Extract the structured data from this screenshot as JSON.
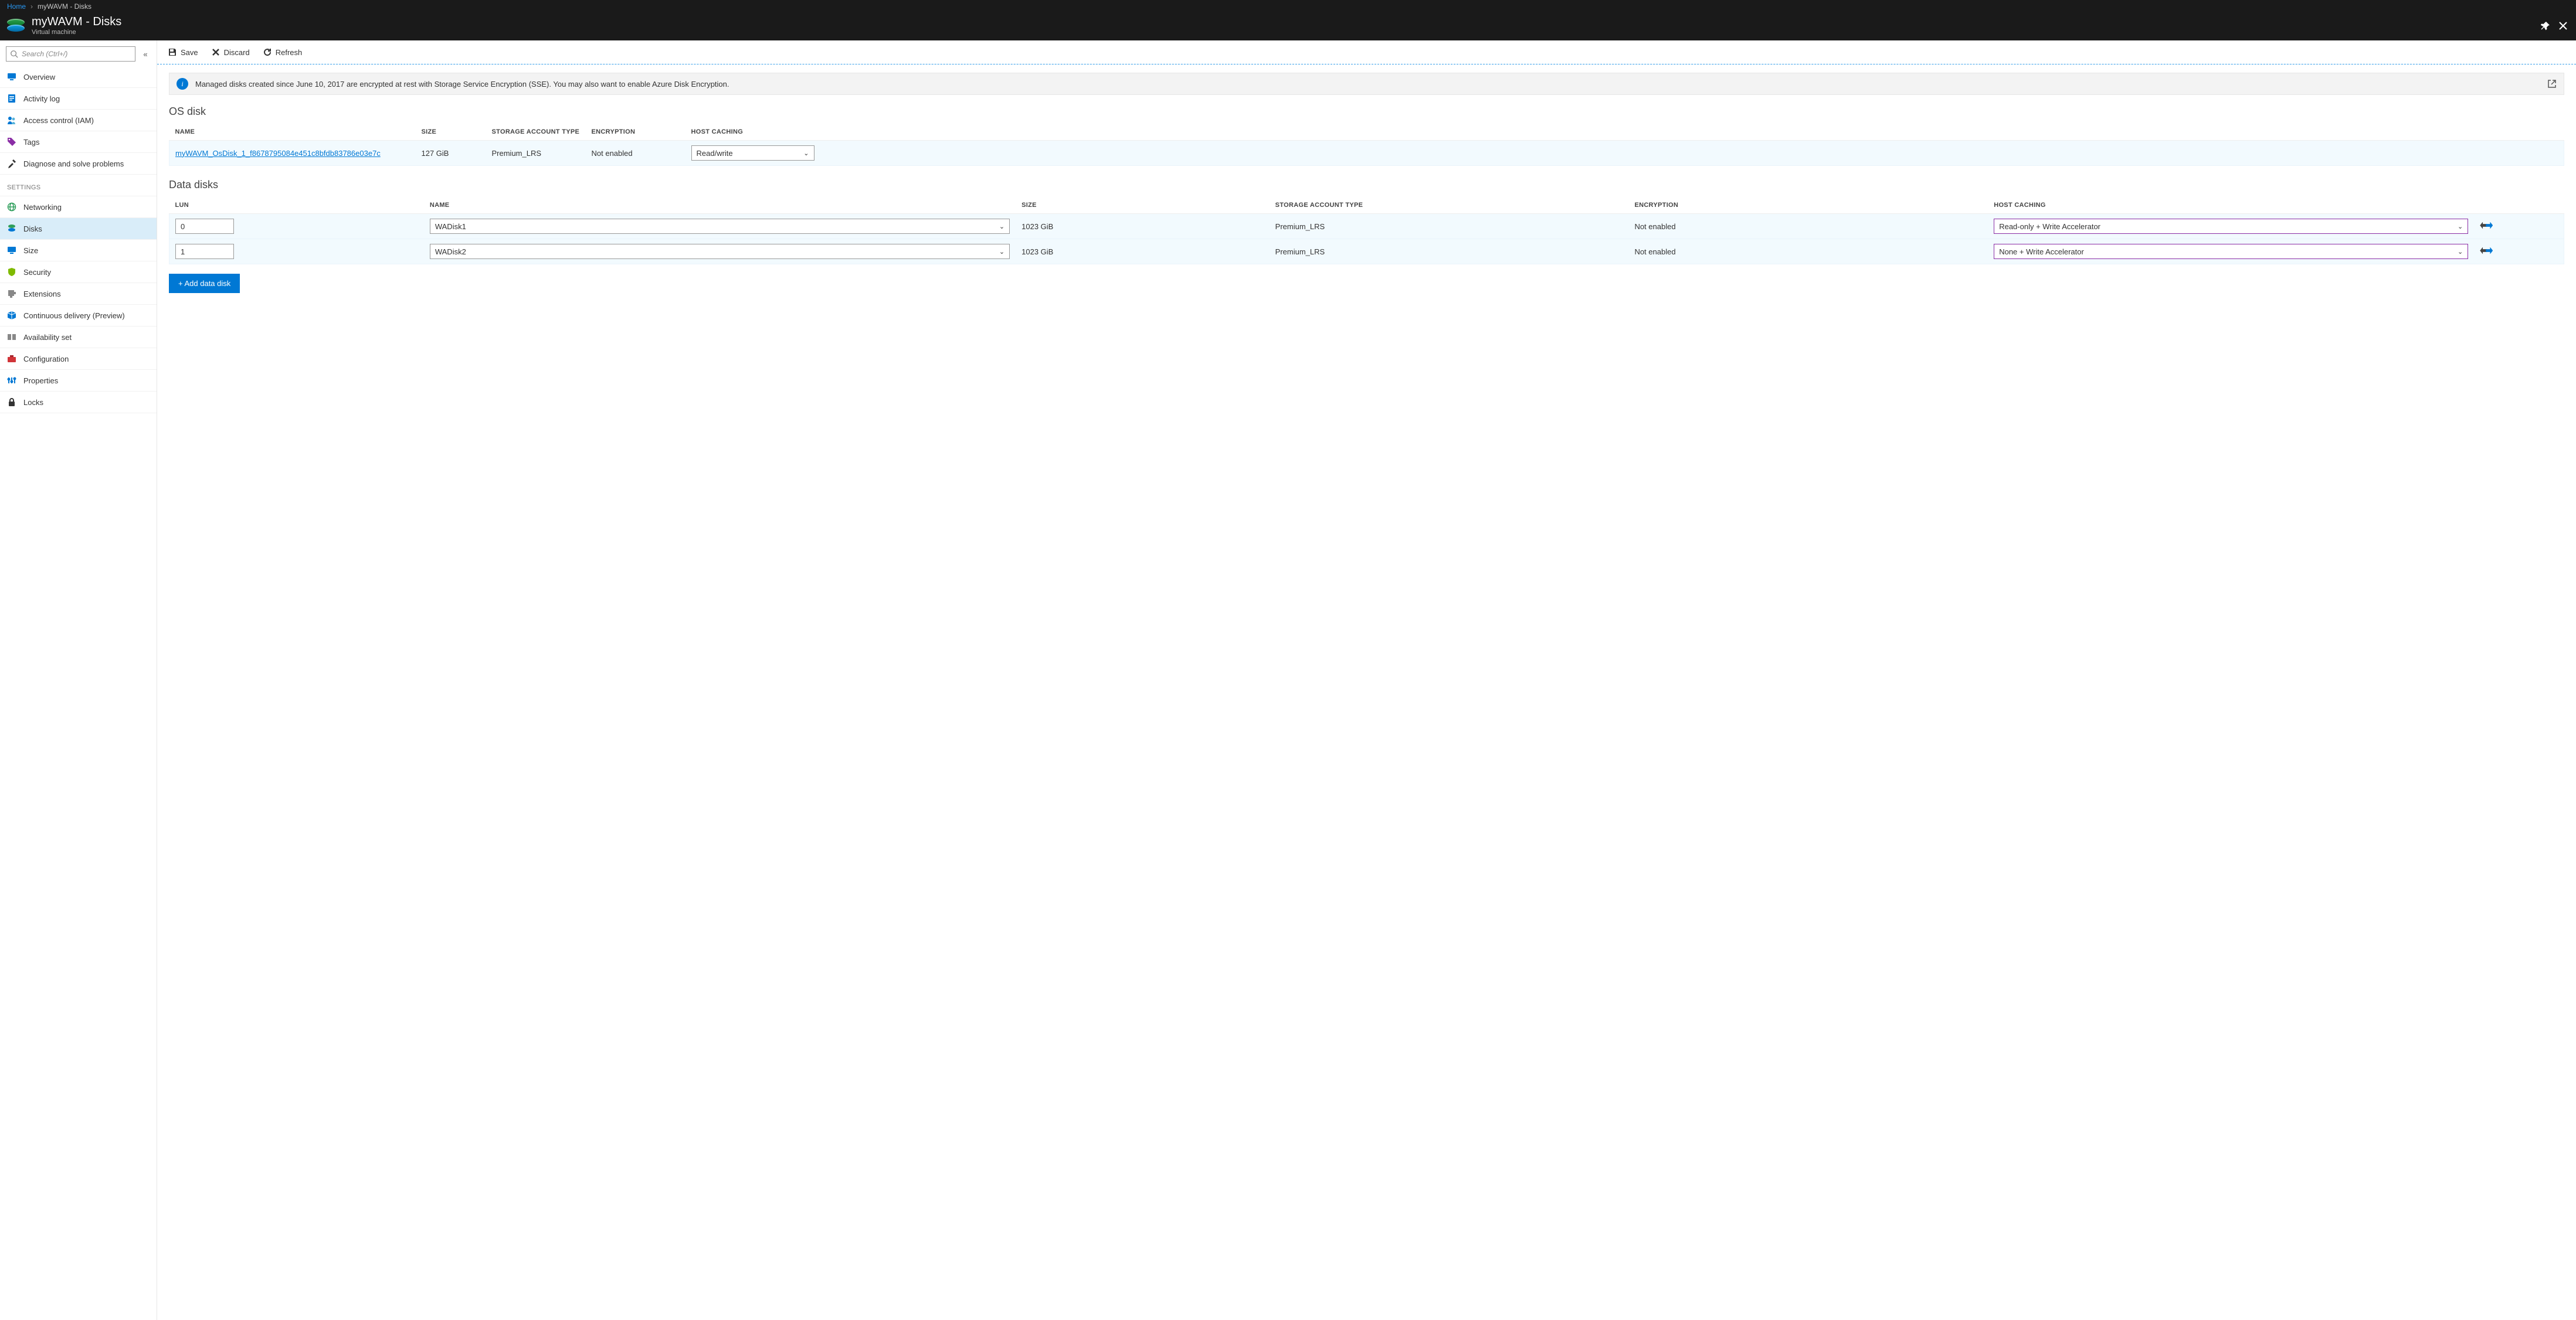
{
  "breadcrumb": {
    "home": "Home",
    "current": "myWAVM - Disks"
  },
  "header": {
    "title": "myWAVM - Disks",
    "subtitle": "Virtual machine"
  },
  "sidebar": {
    "search_placeholder": "Search (Ctrl+/)",
    "items_top": [
      {
        "label": "Overview",
        "icon": "monitor-icon"
      },
      {
        "label": "Activity log",
        "icon": "log-icon"
      },
      {
        "label": "Access control (IAM)",
        "icon": "people-icon"
      },
      {
        "label": "Tags",
        "icon": "tag-icon"
      },
      {
        "label": "Diagnose and solve problems",
        "icon": "tools-icon"
      }
    ],
    "settings_header": "SETTINGS",
    "items_settings": [
      {
        "label": "Networking",
        "icon": "globe-icon"
      },
      {
        "label": "Disks",
        "icon": "disks-icon",
        "selected": true
      },
      {
        "label": "Size",
        "icon": "monitor-icon"
      },
      {
        "label": "Security",
        "icon": "shield-icon"
      },
      {
        "label": "Extensions",
        "icon": "puzzle-icon"
      },
      {
        "label": "Continuous delivery (Preview)",
        "icon": "box-icon"
      },
      {
        "label": "Availability set",
        "icon": "avset-icon"
      },
      {
        "label": "Configuration",
        "icon": "toolbox-icon"
      },
      {
        "label": "Properties",
        "icon": "properties-icon"
      },
      {
        "label": "Locks",
        "icon": "lock-icon"
      }
    ]
  },
  "commands": {
    "save": "Save",
    "discard": "Discard",
    "refresh": "Refresh"
  },
  "info_banner": "Managed disks created since June 10, 2017 are encrypted at rest with Storage Service Encryption (SSE). You may also want to enable Azure Disk Encryption.",
  "os_section": {
    "title": "OS disk",
    "columns": {
      "name": "NAME",
      "size": "SIZE",
      "sat": "STORAGE ACCOUNT TYPE",
      "enc": "ENCRYPTION",
      "hc": "HOST CACHING"
    },
    "row": {
      "name": "myWAVM_OsDisk_1_f8678795084e451c8bfdb83786e03e7c",
      "size": "127 GiB",
      "sat": "Premium_LRS",
      "enc": "Not enabled",
      "hc": "Read/write"
    }
  },
  "data_section": {
    "title": "Data disks",
    "columns": {
      "lun": "LUN",
      "name": "NAME",
      "size": "SIZE",
      "sat": "STORAGE ACCOUNT TYPE",
      "enc": "ENCRYPTION",
      "hc": "HOST CACHING"
    },
    "rows": [
      {
        "lun": "0",
        "name": "WADisk1",
        "size": "1023 GiB",
        "sat": "Premium_LRS",
        "enc": "Not enabled",
        "hc": "Read-only + Write Accelerator"
      },
      {
        "lun": "1",
        "name": "WADisk2",
        "size": "1023 GiB",
        "sat": "Premium_LRS",
        "enc": "Not enabled",
        "hc": "None + Write Accelerator"
      }
    ],
    "add_button": "+ Add data disk"
  }
}
